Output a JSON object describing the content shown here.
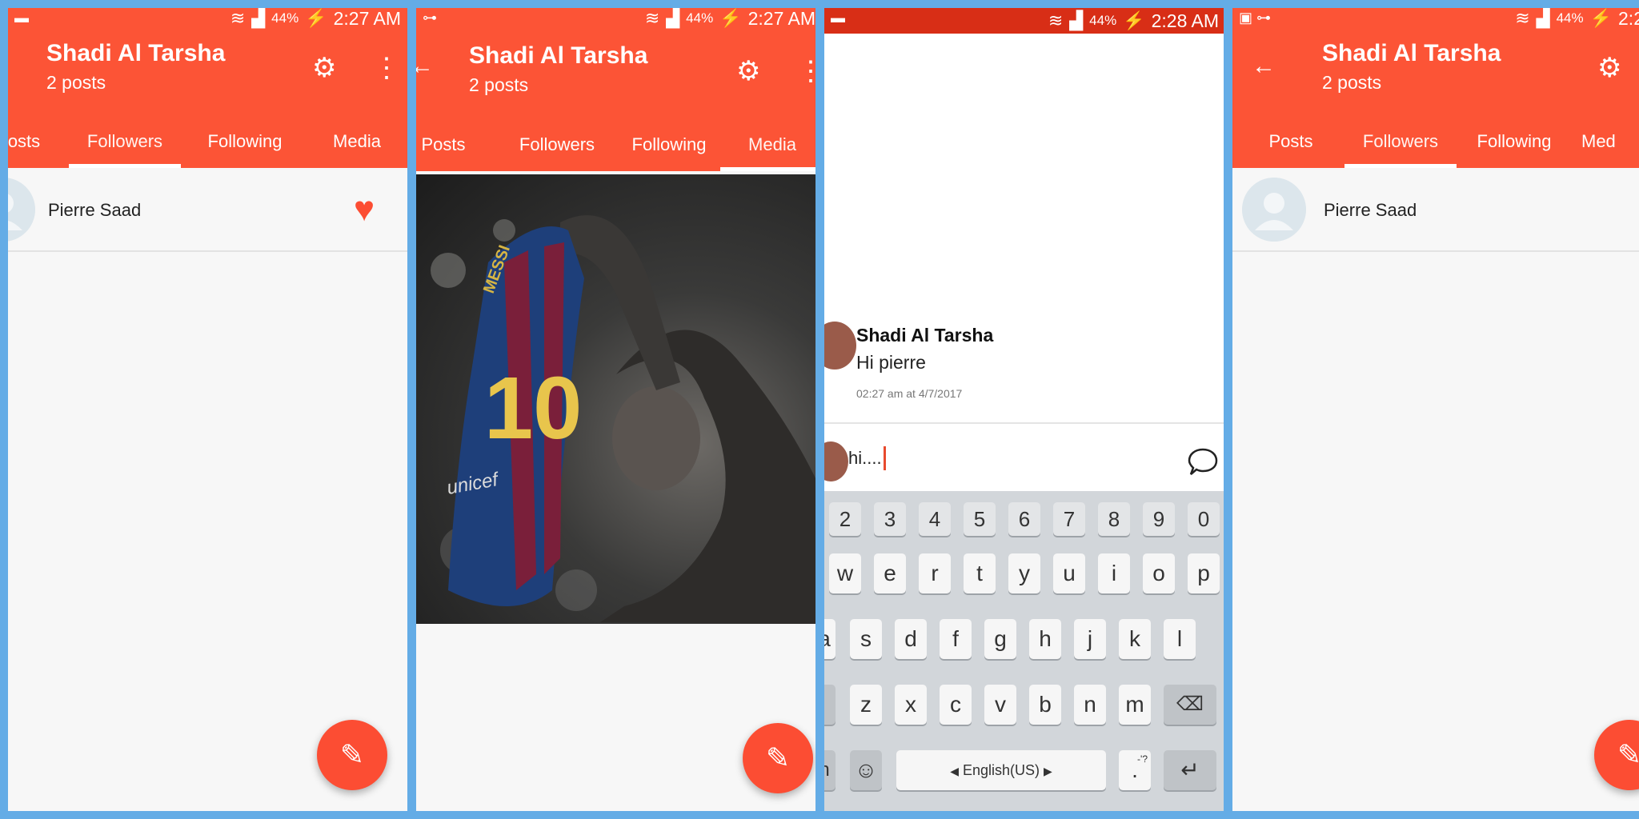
{
  "screens": [
    {
      "status": {
        "left": "▬",
        "battery": "44%",
        "time": "2:27 AM"
      },
      "title": "Shadi Al Tarsha",
      "subtitle": "2 posts",
      "tabs": [
        "osts",
        "Followers",
        "Following",
        "Media"
      ],
      "active_tab": "Followers",
      "follower": {
        "name": "Pierre Saad"
      },
      "fab_icon": "pencil-icon"
    },
    {
      "status": {
        "left": "⊶",
        "battery": "44%",
        "time": "2:27 AM"
      },
      "title": "Shadi Al Tarsha",
      "subtitle": "2 posts",
      "tabs": [
        "Posts",
        "Followers",
        "Following",
        "Media"
      ],
      "active_tab": "Media",
      "fab_icon": "pencil-icon",
      "photo_jersey": {
        "name": "MESSI",
        "number": "10",
        "sponsor": "unicef"
      }
    },
    {
      "status": {
        "left": "▬",
        "battery": "44%",
        "time": "2:28 AM"
      },
      "message": {
        "author": "Shadi Al Tarsha",
        "text": "Hi pierre",
        "time": "02:27 am at 4/7/2017"
      },
      "composer": {
        "value": "hi...."
      },
      "keyboard": {
        "numbers": [
          "2",
          "3",
          "4",
          "5",
          "6",
          "7",
          "8",
          "9",
          "0"
        ],
        "row1": [
          "w",
          "e",
          "r",
          "t",
          "y",
          "u",
          "i",
          "o",
          "p"
        ],
        "row2": [
          "a",
          "s",
          "d",
          "f",
          "g",
          "h",
          "j",
          "k",
          "l"
        ],
        "row3": [
          "z",
          "x",
          "c",
          "v",
          "b",
          "n",
          "m"
        ],
        "space_label": "English(US)",
        "period": ".",
        "period_hint": "-'?",
        "left_key": "n"
      }
    },
    {
      "status": {
        "left": "▣ ⊶",
        "battery": "44%",
        "time": "2:2"
      },
      "title": "Shadi Al Tarsha",
      "subtitle": "2 posts",
      "tabs": [
        "Posts",
        "Followers",
        "Following",
        "Med"
      ],
      "active_tab": "Followers",
      "follower": {
        "name": "Pierre Saad"
      },
      "fab_icon": "pencil-icon"
    }
  ],
  "colors": {
    "primary": "#fc5436",
    "accent": "#fc4d33",
    "status_dark": "#d82e16",
    "frame": "#64ace6"
  }
}
